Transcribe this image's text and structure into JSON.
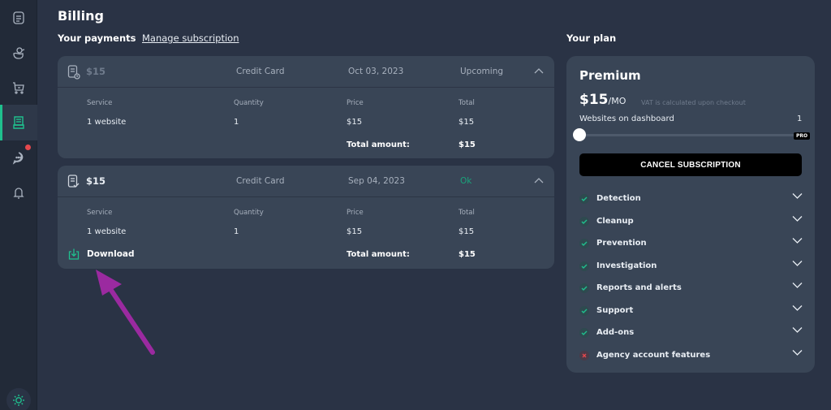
{
  "sidebar": {
    "items": [
      {
        "icon": "document-icon",
        "label": "Dashboard"
      },
      {
        "icon": "duck-icon",
        "label": "Duck"
      },
      {
        "icon": "cart-icon",
        "label": "Cart"
      },
      {
        "icon": "receipt-icon",
        "label": "Billing",
        "active": true
      },
      {
        "icon": "chat-icon",
        "label": "Messages",
        "notification": true
      },
      {
        "icon": "bell-icon",
        "label": "Notifications"
      }
    ],
    "theme_toggle": "sun-icon"
  },
  "page": {
    "title": "Billing",
    "payments_heading": "Your payments",
    "manage_link": "Manage subscription",
    "plan_heading": "Your plan"
  },
  "payments": [
    {
      "amount": "$15",
      "method": "Credit Card",
      "date": "Oct 03, 2023",
      "status": "Upcoming",
      "columns": [
        "Service",
        "Quantity",
        "Price",
        "Total"
      ],
      "row": [
        "1 website",
        "1",
        "$15",
        "$15"
      ],
      "total_label": "Total amount:",
      "total_value": "$15"
    },
    {
      "amount": "$15",
      "method": "Credit Card",
      "date": "Sep 04, 2023",
      "status": "Ok",
      "columns": [
        "Service",
        "Quantity",
        "Price",
        "Total"
      ],
      "row": [
        "1 website",
        "1",
        "$15",
        "$15"
      ],
      "download_label": "Download",
      "total_label": "Total amount:",
      "total_value": "$15"
    }
  ],
  "plan": {
    "name": "Premium",
    "price": "$15",
    "period": "/MO",
    "vat_note": "VAT is calculated upon checkout",
    "websites_label": "Websites on dashboard",
    "websites_value": "1",
    "slider_fraction": 0,
    "pro_badge": "PRO",
    "cancel_label": "CANCEL SUBSCRIPTION",
    "features": [
      {
        "label": "Detection",
        "included": true
      },
      {
        "label": "Cleanup",
        "included": true
      },
      {
        "label": "Prevention",
        "included": true
      },
      {
        "label": "Investigation",
        "included": true
      },
      {
        "label": "Reports and alerts",
        "included": true
      },
      {
        "label": "Support",
        "included": true
      },
      {
        "label": "Add-ons",
        "included": true
      },
      {
        "label": "Agency account features",
        "included": false
      }
    ]
  },
  "colors": {
    "accent": "#1fc08e",
    "ok_status": "#1aa37b",
    "notification": "#e5484d",
    "annotation_arrow": "#9b2aa0"
  }
}
